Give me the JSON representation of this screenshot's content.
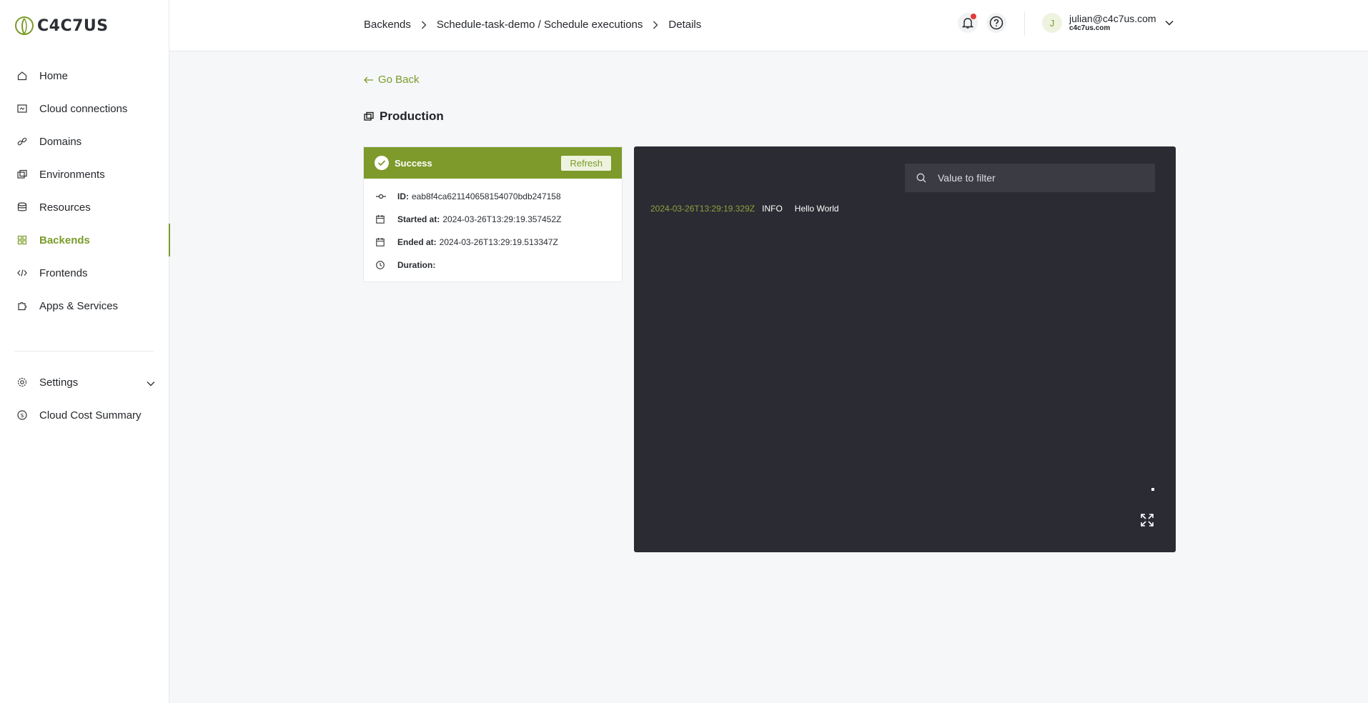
{
  "logo": {
    "text": "C4C7US"
  },
  "sidebar": {
    "items": [
      {
        "label": "Home",
        "icon": "home-icon"
      },
      {
        "label": "Cloud connections",
        "icon": "cloud-connections-icon"
      },
      {
        "label": "Domains",
        "icon": "link-icon"
      },
      {
        "label": "Environments",
        "icon": "environments-icon"
      },
      {
        "label": "Resources",
        "icon": "database-icon"
      },
      {
        "label": "Backends",
        "icon": "grid-icon",
        "active": true
      },
      {
        "label": "Frontends",
        "icon": "code-icon"
      },
      {
        "label": "Apps & Services",
        "icon": "puzzle-icon"
      }
    ],
    "bottom_items": [
      {
        "label": "Settings",
        "icon": "gear-icon"
      },
      {
        "label": "Cloud Cost Summary",
        "icon": "dollar-icon"
      }
    ]
  },
  "header": {
    "breadcrumb": [
      "Backends",
      "Schedule-task-demo / Schedule executions",
      "Details"
    ],
    "user": {
      "initial": "J",
      "email": "julian@c4c7us.com",
      "org": "c4c7us.com"
    }
  },
  "main": {
    "go_back": "Go Back",
    "title": "Production",
    "status": {
      "label": "Success",
      "refresh": "Refresh",
      "id_label": "ID:",
      "id_value": "eab8f4ca621140658154070bdb247158",
      "started_label": "Started at:",
      "started_value": "2024-03-26T13:29:19.357452Z",
      "ended_label": "Ended at:",
      "ended_value": "2024-03-26T13:29:19.513347Z",
      "duration_label": "Duration:",
      "duration_value": ""
    },
    "logs": {
      "filter_placeholder": "Value to filter",
      "lines": [
        {
          "timestamp": "2024-03-26T13:29:19.329Z",
          "level": "INFO",
          "message": "Hello World"
        }
      ]
    }
  },
  "colors": {
    "accent": "#7a9b2a",
    "status_success": "#7d9a2b",
    "log_bg": "#2b2b33",
    "notification": "#e03b3b"
  }
}
